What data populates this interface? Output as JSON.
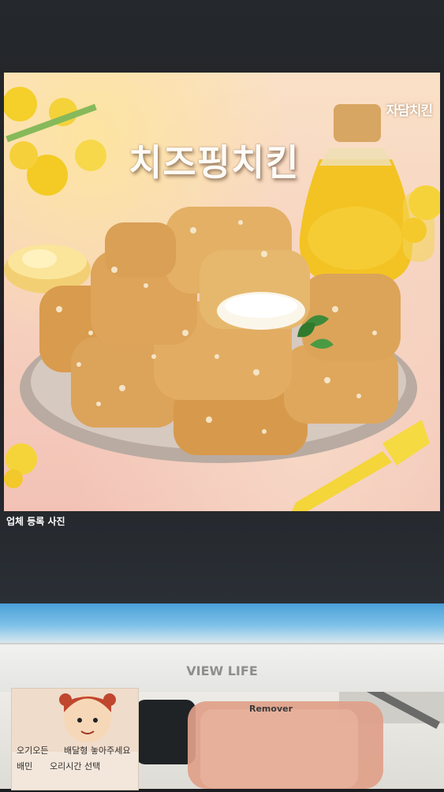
{
  "screen": {
    "photo": {
      "brand_logo": "자담치킨",
      "headline": "치즈핑치킨"
    },
    "caption": "업체 등록 사진"
  },
  "monitor": {
    "bezel_logo": "VIEW LIFE"
  },
  "desk": {
    "note_lines": [
      "오기오든",
      "배민",
      "배달형 놓아주세요",
      "오리시간 선택"
    ],
    "bottle_label": "Remover"
  },
  "colors": {
    "screen_bg": "#1e2024",
    "bezel": "#eaeae7",
    "oil": "#f2c21a"
  }
}
